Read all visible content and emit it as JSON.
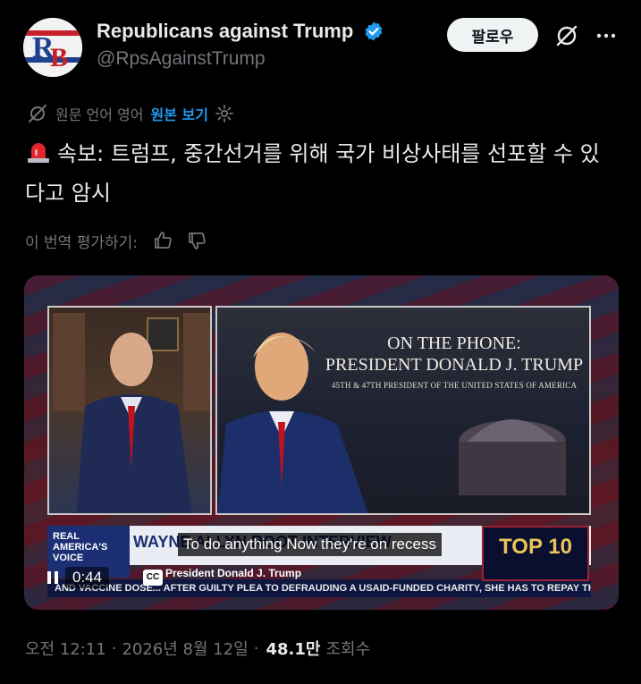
{
  "account": {
    "display_name": "Republicans against Trump",
    "handle": "@RpsAgainstTrump",
    "avatar_text": "RB",
    "verified_color": "#1d9bf0",
    "follow_label": "팔로우"
  },
  "translation": {
    "label": "원문 언어 영어",
    "show_original": "원본 보기"
  },
  "tweet": {
    "text": "속보: 트럼프, 중간선거를 위해 국가 비상사태를 선포할 수 있다고 암시",
    "emoji_icon": "siren-icon"
  },
  "rate": {
    "label": "이 번역 평가하기:"
  },
  "video": {
    "phone_title_1": "ON THE PHONE:",
    "phone_title_2": "PRESIDENT DONALD J. TRUMP",
    "phone_sub": "45TH & 47TH PRESIDENT OF THE UNITED STATES OF AMERICA",
    "network_logo_1": "REAL",
    "network_logo_2": "AMERICA'S",
    "network_logo_3": "VOICE",
    "lower_third_name": "WAYNE ALLYN ROOT INTERVIEW",
    "lower_third_sub": "President Donald J. Trump",
    "ticker_text": "AND VACCINE DOSE... AFTER GUILTY PLEA TO DEFRAUDING A USAID-FUNDED CHARITY, SHE HAS TO REPAY TH",
    "badge_text": "TOP 10",
    "subtitle": "To do anything Now they're on recess",
    "elapsed": "0:44",
    "cc_label": "CC"
  },
  "meta": {
    "time": "오전 12:11",
    "sep1": "·",
    "date": "2026년 8월 12일",
    "sep2": "·",
    "views": "48.1만",
    "views_label": "조회수"
  }
}
